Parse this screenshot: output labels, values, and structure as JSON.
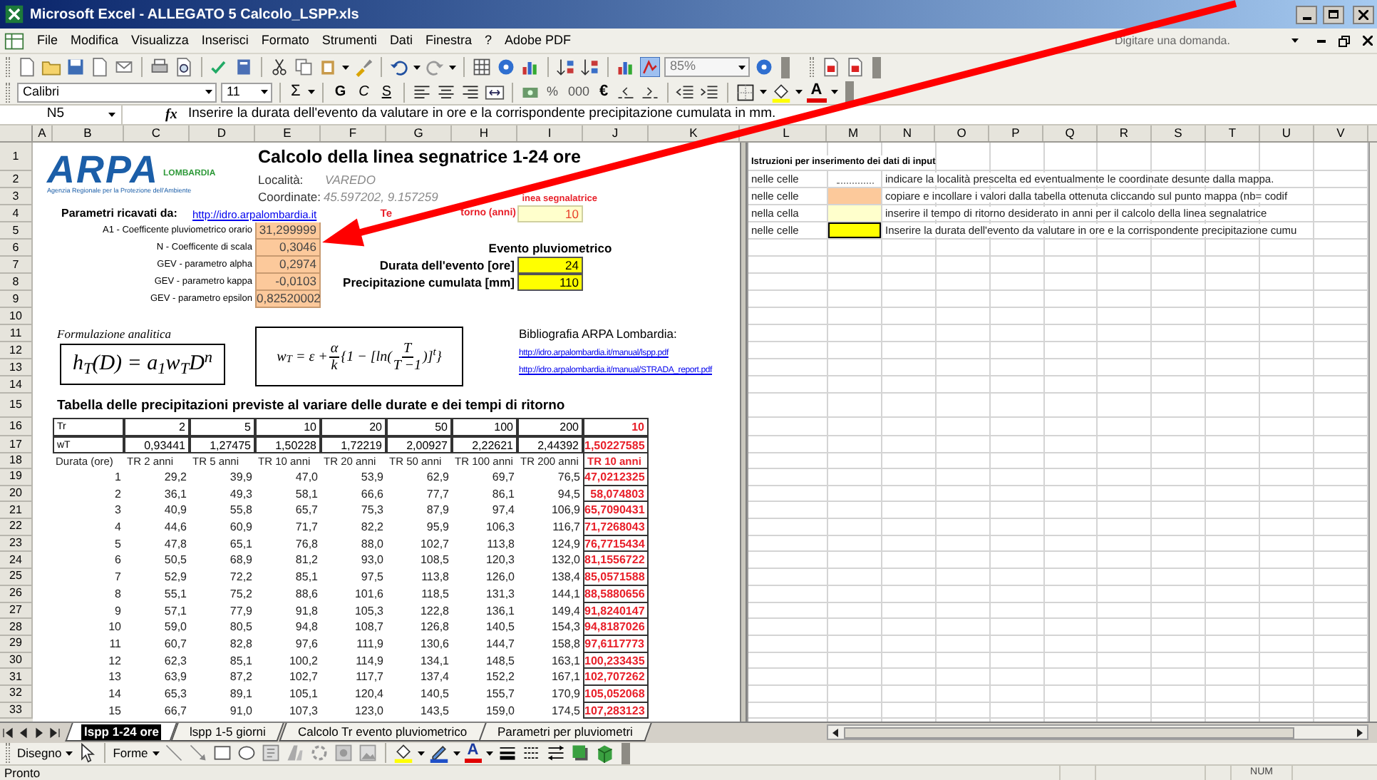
{
  "window": {
    "title": "Microsoft Excel - ALLEGATO 5 Calcolo_LSPP.xls"
  },
  "menu": [
    "File",
    "Modifica",
    "Visualizza",
    "Inserisci",
    "Formato",
    "Strumenti",
    "Dati",
    "Finestra",
    "?",
    "Adobe PDF"
  ],
  "help_search": {
    "placeholder": "Digitare una domanda."
  },
  "zoom": "85%",
  "font": {
    "name": "Calibri",
    "size": "11"
  },
  "format_toolbar": {
    "autosum": "Σ",
    "styles": [
      "G",
      "C",
      "S"
    ],
    "number_formats": [
      "%",
      "000",
      "€"
    ],
    "font_color": "A"
  },
  "name_box": "N5",
  "fx_label": "fx",
  "formula": "Inserire la durata dell'evento da valutare in ore e la corrispondente precipitazione cumulata in mm.",
  "columns_left": [
    "A",
    "B",
    "C",
    "D",
    "E",
    "F",
    "G",
    "H",
    "I",
    "J",
    "K"
  ],
  "columns_right": [
    "L",
    "M",
    "N",
    "O",
    "P",
    "Q",
    "R",
    "S",
    "T",
    "U",
    "V"
  ],
  "row_numbers": [
    "1",
    "2",
    "3",
    "4",
    "5",
    "6",
    "7",
    "8",
    "9",
    "10",
    "11",
    "12",
    "13",
    "14",
    "15",
    "16",
    "17",
    "18",
    "19",
    "20",
    "21",
    "22",
    "23",
    "24",
    "25",
    "26",
    "27",
    "28",
    "29",
    "30",
    "31",
    "32",
    "33"
  ],
  "logo": {
    "name": "ARPA",
    "region": "LOMBARDIA",
    "tagline": "Agenzia Regionale per la Protezione dell'Ambiente"
  },
  "title": "Calcolo della linea segnatrice 1-24 ore",
  "location": {
    "label": "Località:",
    "value": "VAREDO"
  },
  "coordinates": {
    "label": "Coordinate:",
    "value": "45.597202, 9.157259"
  },
  "curve_heading": "inea segnalatrice",
  "source": {
    "label": "Parametri ricavati da:",
    "link": "http://idro.arpalombardia.it"
  },
  "return_period": {
    "label_start": "Te",
    "label_end": "torno (anni)",
    "value": "10"
  },
  "parameters": [
    {
      "label": "A1 - Coefficente pluviometrico orario",
      "value": "31,299999"
    },
    {
      "label": "N - Coefficente di scala",
      "value": "0,3046"
    },
    {
      "label": "GEV - parametro alpha",
      "value": "0,2974"
    },
    {
      "label": "GEV - parametro kappa",
      "value": "-0,0103"
    },
    {
      "label": "GEV - parametro epsilon",
      "value": "0,82520002"
    }
  ],
  "event": {
    "title": "Evento pluviometrico",
    "fields": [
      {
        "label": "Durata dell'evento [ore]",
        "value": "24"
      },
      {
        "label": "Precipitazione cumulata [mm]",
        "value": "110"
      }
    ]
  },
  "formula_caption": "Formulazione analitica",
  "formula_1": "h$_{T}$(D) = a$_{1}$w$_{T}$D$^{n}$",
  "formula_2": {
    "lhs": "w$_{T}$ = ε +",
    "frac_1": {
      "num": "α",
      "den": "k"
    },
    "middle": "{1 − [ln(",
    "frac_2": {
      "num": "T",
      "den": "T −1"
    },
    "end": ")]$^{t}$}"
  },
  "bibliography": {
    "title": "Bibliografia ARPA Lombardia:",
    "links": [
      "http://idro.arpalombardia.it/manual/lspp.pdf",
      "http://idro.arpalombardia.it/manual/STRADA_report.pdf"
    ]
  },
  "table": {
    "title": "Tabella delle precipitazioni previste al variare delle durate e dei tempi di ritorno",
    "header_rows": [
      {
        "label": "Tr",
        "values": [
          "2",
          "5",
          "10",
          "20",
          "50",
          "100",
          "200",
          "10"
        ]
      },
      {
        "label": "wT",
        "values": [
          "0,93441",
          "1,27475",
          "1,50228",
          "1,72219",
          "2,00927",
          "2,22621",
          "2,44392",
          "1,50227585"
        ]
      }
    ],
    "columns": [
      "Durata (ore)",
      "TR 2 anni",
      "TR 5 anni",
      "TR 10 anni",
      "TR 20 anni",
      "TR 50 anni",
      "TR 100 anni",
      "TR 200 anni",
      "TR 10 anni"
    ],
    "rows": [
      [
        "1",
        "29,2",
        "39,9",
        "47,0",
        "53,9",
        "62,9",
        "69,7",
        "76,5",
        "47,0212325"
      ],
      [
        "2",
        "36,1",
        "49,3",
        "58,1",
        "66,6",
        "77,7",
        "86,1",
        "94,5",
        "58,074803"
      ],
      [
        "3",
        "40,9",
        "55,8",
        "65,7",
        "75,3",
        "87,9",
        "97,4",
        "106,9",
        "65,7090431"
      ],
      [
        "4",
        "44,6",
        "60,9",
        "71,7",
        "82,2",
        "95,9",
        "106,3",
        "116,7",
        "71,7268043"
      ],
      [
        "5",
        "47,8",
        "65,1",
        "76,8",
        "88,0",
        "102,7",
        "113,8",
        "124,9",
        "76,7715434"
      ],
      [
        "6",
        "50,5",
        "68,9",
        "81,2",
        "93,0",
        "108,5",
        "120,3",
        "132,0",
        "81,1556722"
      ],
      [
        "7",
        "52,9",
        "72,2",
        "85,1",
        "97,5",
        "113,8",
        "126,0",
        "138,4",
        "85,0571588"
      ],
      [
        "8",
        "55,1",
        "75,2",
        "88,6",
        "101,6",
        "118,5",
        "131,3",
        "144,1",
        "88,5880656"
      ],
      [
        "9",
        "57,1",
        "77,9",
        "91,8",
        "105,3",
        "122,8",
        "136,1",
        "149,4",
        "91,8240147"
      ],
      [
        "10",
        "59,0",
        "80,5",
        "94,8",
        "108,7",
        "126,8",
        "140,5",
        "154,3",
        "94,8187026"
      ],
      [
        "11",
        "60,7",
        "82,8",
        "97,6",
        "111,9",
        "130,6",
        "144,7",
        "158,8",
        "97,6117773"
      ],
      [
        "12",
        "62,3",
        "85,1",
        "100,2",
        "114,9",
        "134,1",
        "148,5",
        "163,1",
        "100,233435"
      ],
      [
        "13",
        "63,9",
        "87,2",
        "102,7",
        "117,7",
        "137,4",
        "152,2",
        "167,1",
        "102,707262"
      ],
      [
        "14",
        "65,3",
        "89,1",
        "105,1",
        "120,4",
        "140,5",
        "155,7",
        "170,9",
        "105,052068"
      ],
      [
        "15",
        "66,7",
        "91,0",
        "107,3",
        "123,0",
        "143,5",
        "159,0",
        "174,5",
        "107,283123"
      ]
    ]
  },
  "instructions": {
    "title": "Istruzioni per inserimento dei dati di input",
    "rows": [
      {
        "prefix": "nelle celle",
        "kind": "dotted",
        "text": "indicare la località prescelta ed eventualmente le coordinate desunte dalla mappa."
      },
      {
        "prefix": "nelle celle",
        "kind": "peach",
        "text": "copiare e incollare i valori dalla tabella ottenuta cliccando sul punto mappa  (nb= codif"
      },
      {
        "prefix": "nella cella",
        "kind": "light_yellow",
        "text": "inserire il tempo di ritorno desiderato in anni per il calcolo della linea segnalatrice"
      },
      {
        "prefix": "nelle celle",
        "kind": "yellow",
        "text": "Inserire la durata dell'evento da valutare in ore e la corrispondente precipitazione cumu"
      }
    ]
  },
  "sheet_tabs": [
    {
      "label": "lspp 1-24 ore",
      "selected": true
    },
    {
      "label": "lspp 1-5 giorni",
      "selected": false
    },
    {
      "label": "Calcolo Tr evento pluviometrico",
      "selected": false
    },
    {
      "label": "Parametri per pluviometri",
      "selected": false
    }
  ],
  "drawing_toolbar": {
    "draw": "Disegno",
    "shapes": "Forme",
    "font_color": "A"
  },
  "status": {
    "text": "Pronto",
    "indicator": "NUM"
  }
}
